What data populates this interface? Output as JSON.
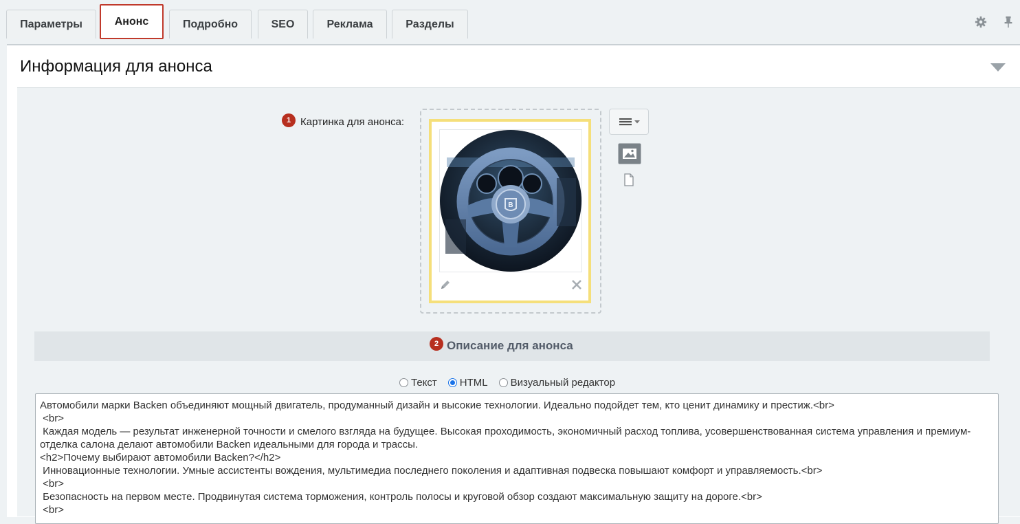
{
  "tabs": [
    "Параметры",
    "Анонс",
    "Подробно",
    "SEO",
    "Реклама",
    "Разделы"
  ],
  "active_tab": "Анонс",
  "header_icons": [
    "gear-icon",
    "pin-icon"
  ],
  "section": {
    "title": "Информация для анонса"
  },
  "preview_image": {
    "label": "Картинка для анонса:",
    "badge": "1",
    "icons": [
      "edit-icon",
      "close-icon",
      "menu-icon",
      "image-icon",
      "file-icon"
    ]
  },
  "description": {
    "badge": "2",
    "title": "Описание для анонса",
    "modes": [
      "Текст",
      "HTML",
      "Визуальный редактор"
    ],
    "selected_mode": "HTML",
    "text": "Автомобили марки Backen объединяют мощный двигатель, продуманный дизайн и высокие технологии. Идеально подойдет тем, кто ценит динамику и престиж.<br>\n <br>\n Каждая модель — результат инженерной точности и смелого взгляда на будущее. Высокая проходимость, экономичный расход топлива, усовершенствованная система управления и премиум-отделка салона делают автомобили Backen идеальными для города и трассы.\n<h2>Почему выбирают автомобили Backen?</h2>\n Инновационные технологии. Умные ассистенты вождения, мультимедиа последнего поколения и адаптивная подвеска повышают комфорт и управляемость.<br>\n <br>\n Безопасность на первом месте. Продвинутая система торможения, контроль полосы и круговой обзор создают максимальную защиту на дороге.<br>\n <br>"
  },
  "colors": {
    "badge": "#b72f1f",
    "active_tab_border": "#c0392b",
    "image_card_border": "#f5df7a",
    "radio_selected": "#1a73e8"
  }
}
